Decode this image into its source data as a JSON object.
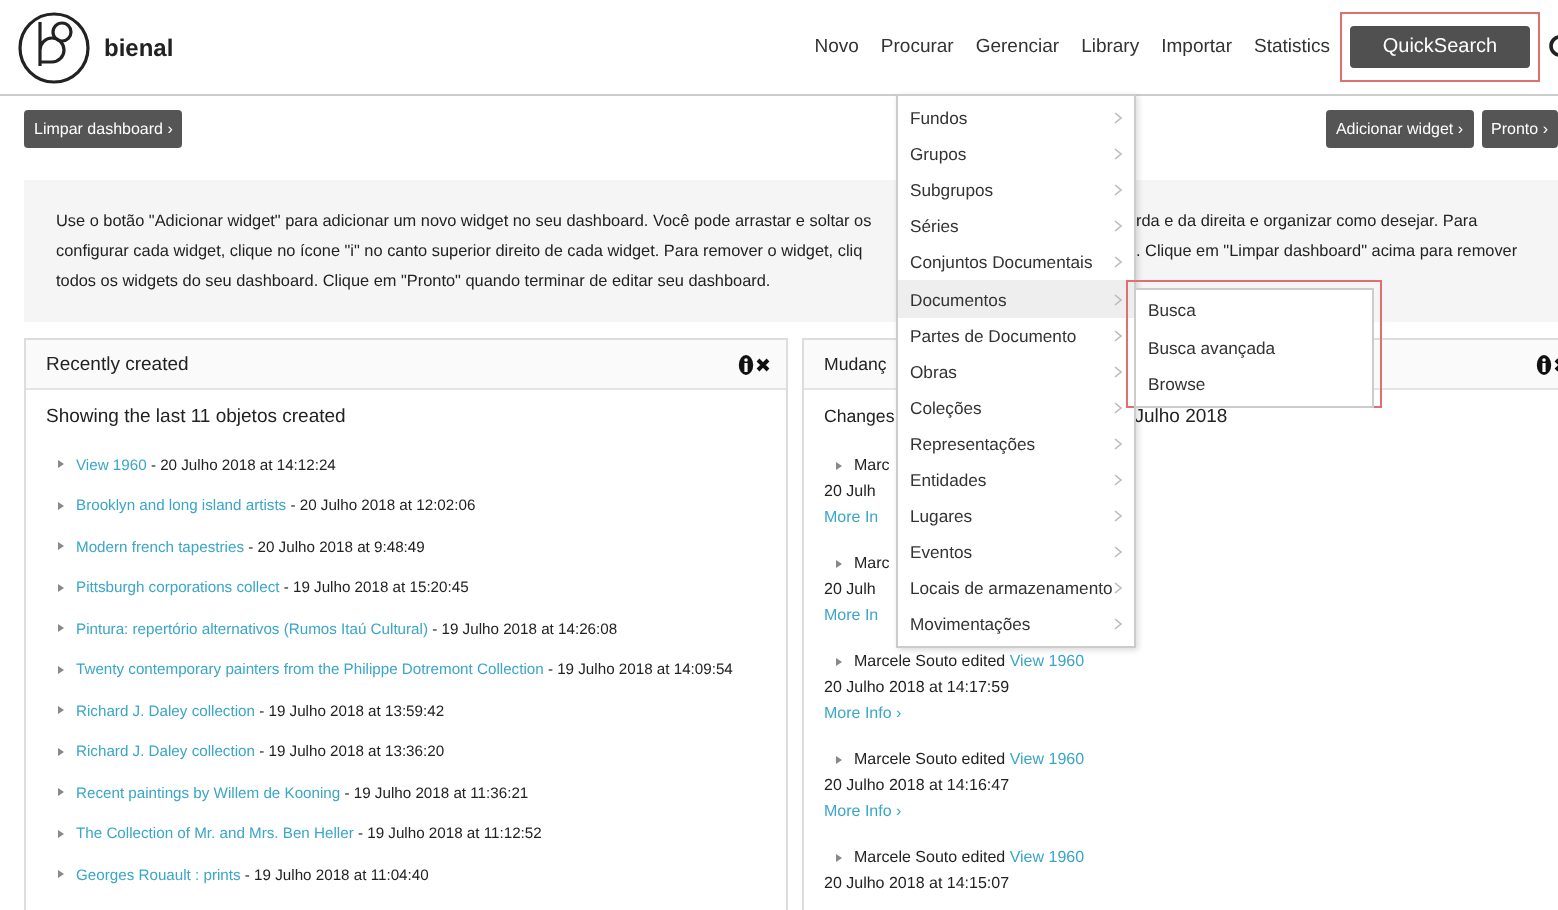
{
  "brand": {
    "name": "bienal"
  },
  "nav": {
    "items": [
      "Novo",
      "Procurar",
      "Gerenciar",
      "Library",
      "Importar",
      "Statistics"
    ],
    "quicksearch": "QuickSearch"
  },
  "toolbar": {
    "left_buttons": [
      "Limpar dashboard ›"
    ],
    "right_buttons": [
      "Adicionar widget ›",
      "Pronto ›"
    ]
  },
  "info_lines": [
    {
      "left": "Use o botão \"Adicionar widget\" para adicionar um novo widget no seu dashboard. Você pode arrastar e soltar os",
      "right": "rda e da direita e organizar como desejar. Para"
    },
    {
      "left": "configurar cada widget, clique no ícone \"i\" no canto superior direito de cada widget. Para remover o widget, cliq",
      "right": ". Clique em \"Limpar dashboard\" acima para remover"
    },
    {
      "left": "todos os widgets do seu dashboard. Clique em \"Pronto\" quando terminar de editar seu dashboard."
    }
  ],
  "recent": {
    "title": "Recently created",
    "subtitle": "Showing the last 11 objetos created",
    "items": [
      {
        "link": "View 1960",
        "date": " - 20 Julho 2018 at 14:12:24"
      },
      {
        "link": "Brooklyn and long island artists",
        "date": " - 20 Julho 2018 at 12:02:06"
      },
      {
        "link": "Modern french tapestries",
        "date": " - 20 Julho 2018 at 9:48:49"
      },
      {
        "link": "Pittsburgh corporations collect",
        "date": " - 19 Julho 2018 at 15:20:45"
      },
      {
        "link": "Pintura: repertório alternativos (Rumos Itaú Cultural)",
        "date": " - 19 Julho 2018 at 14:26:08"
      },
      {
        "link": "Twenty contemporary painters from the Philippe Dotremont Collection",
        "date": " - 19 Julho 2018 at 14:09:54"
      },
      {
        "link": "Richard J. Daley collection",
        "date": " - 19 Julho 2018 at 13:59:42"
      },
      {
        "link": "Richard J. Daley collection",
        "date": " - 19 Julho 2018 at 13:36:20"
      },
      {
        "link": "Recent paintings by Willem de Kooning",
        "date": " - 19 Julho 2018 at 11:36:21"
      },
      {
        "link": "The Collection of Mr. and Mrs. Ben Heller",
        "date": " - 19 Julho 2018 at 11:12:52"
      },
      {
        "link": "Georges Rouault : prints",
        "date": " - 19 Julho 2018 at 11:04:40"
      }
    ]
  },
  "changes": {
    "title": "Mudanç",
    "heading_left": "Changes",
    "heading_right": "Julho 2018",
    "entries": [
      {
        "text": "Marc",
        "date": "20 Julh",
        "more": "More In"
      },
      {
        "text": "Marc",
        "date": "20 Julh",
        "more": "More In"
      },
      {
        "text": "Marcele Souto edited ",
        "link": "View 1960",
        "date": "20 Julho 2018 at 14:17:59",
        "more": "More Info ›"
      },
      {
        "text": "Marcele Souto edited ",
        "link": "View 1960",
        "date": "20 Julho 2018 at 14:16:47",
        "more": "More Info ›"
      },
      {
        "text": "Marcele Souto edited ",
        "link": "View 1960",
        "date": "20 Julho 2018 at 14:15:07"
      }
    ]
  },
  "menu": {
    "items": [
      {
        "label": "Fundos",
        "selected": false
      },
      {
        "label": "Grupos",
        "selected": false
      },
      {
        "label": "Subgrupos",
        "selected": false
      },
      {
        "label": "Séries",
        "selected": false
      },
      {
        "label": "Conjuntos Documentais",
        "selected": false
      },
      {
        "label": "Documentos",
        "selected": true
      },
      {
        "label": "Partes de Documento",
        "selected": false
      },
      {
        "label": "Obras",
        "selected": false
      },
      {
        "label": "Coleções",
        "selected": false
      },
      {
        "label": "Representações",
        "selected": false
      },
      {
        "label": "Entidades",
        "selected": false
      },
      {
        "label": "Lugares",
        "selected": false
      },
      {
        "label": "Eventos",
        "selected": false
      },
      {
        "label": "Locais de armazenamento",
        "selected": false
      },
      {
        "label": "Movimentações",
        "selected": false
      }
    ],
    "submenu": [
      "Busca",
      "Busca avançada",
      "Browse"
    ]
  }
}
